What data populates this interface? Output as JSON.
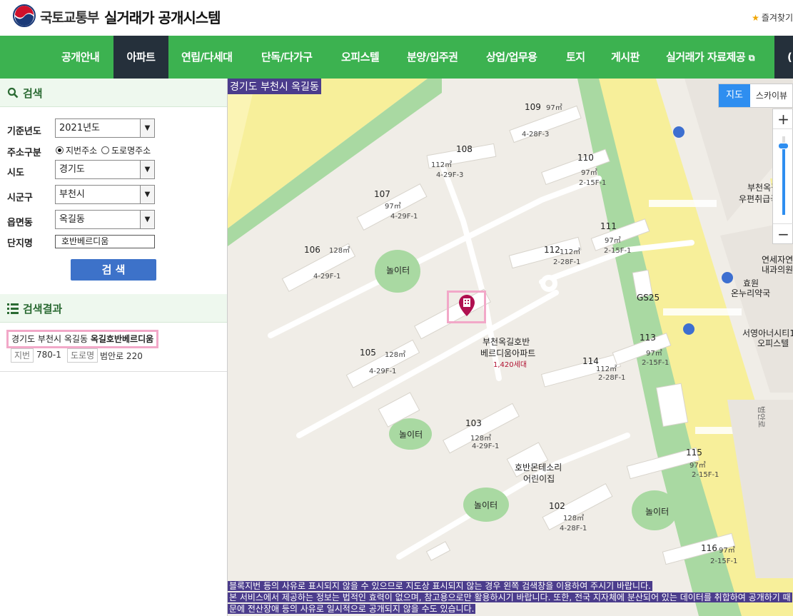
{
  "header": {
    "org": "국토교통부",
    "system": "실거래가 공개시스템",
    "favorite": "즐겨찾기"
  },
  "nav": {
    "items": [
      {
        "label": "공개안내",
        "active": false
      },
      {
        "label": "아파트",
        "active": true
      },
      {
        "label": "연립/다세대",
        "active": false
      },
      {
        "label": "단독/다가구",
        "active": false
      },
      {
        "label": "오피스텔",
        "active": false
      },
      {
        "label": "분양/입주권",
        "active": false
      },
      {
        "label": "상업/업무용",
        "active": false
      },
      {
        "label": "토지",
        "active": false
      },
      {
        "label": "게시판",
        "active": false
      },
      {
        "label": "실거래가 자료제공",
        "active": false
      }
    ]
  },
  "search": {
    "title": "검색",
    "year_label": "기준년도",
    "year_value": "2021년도",
    "addr_type_label": "주소구분",
    "addr_option_lot": "지번주소",
    "addr_option_road": "도로명주소",
    "sido_label": "시도",
    "sido_value": "경기도",
    "sigungu_label": "시군구",
    "sigungu_value": "부천시",
    "dong_label": "읍면동",
    "dong_value": "옥길동",
    "complex_label": "단지명",
    "complex_value": "호반베르디움",
    "button": "검 색"
  },
  "results": {
    "title": "검색결과",
    "item_address": "경기도 부천시 옥길동",
    "item_name": "옥길호반베르디움",
    "lot_tag": "지번",
    "lot_value": "780-1",
    "road_tag": "도로명",
    "road_value": "범안로 220"
  },
  "map": {
    "location_label": "경기도 부천시 옥길동",
    "type_map": "지도",
    "type_sky": "스카이뷰",
    "zoom_in": "+",
    "zoom_out": "−",
    "notice_1": "블록지번 등의 사유로 표시되지 않을 수 있으므로 지도상 표시되지 않는 경우 왼쪽 검색창을 이용하여 주시기 바랍니다.",
    "notice_2": "본 서비스에서 제공하는 정보는 법적인 효력이 없으며, 참고용으로만 활용하시기 바랍니다. 또한, 전국 지자체에 분산되어 있는 데이터를 취합하여 공개하기 때",
    "notice_3": "문에 전산장애 등의 사유로 일시적으로 공개되지 않을 수도 있습니다.",
    "complex_name_1": "부천옥길호반",
    "complex_name_2": "베르디움아파트",
    "households": "1,420세대",
    "playground": "놀이터",
    "daycare_1": "호반몬테소리",
    "daycare_2": "어린이집",
    "store": "GS25",
    "post_1": "부천옥길동",
    "post_2": "우편취급국",
    "clinic_1": "연세자연",
    "clinic_2": "내과의원",
    "pharmacy_1": "효원",
    "pharmacy_2": "온누리약국",
    "officetel_1": "서영아너시티1",
    "officetel_2": "오피스텔",
    "road_name": "범안로",
    "buildings": [
      {
        "no": "107",
        "plot": "4-29F-1",
        "area": "97㎡"
      },
      {
        "no": "108",
        "plot": "4-29F-3",
        "area": "112㎡"
      },
      {
        "no": "109",
        "plot": "4-28F-3",
        "area": "97㎡"
      },
      {
        "no": "110",
        "plot": "2-15F-1",
        "area": "97㎡"
      },
      {
        "no": "106",
        "plot": "4-29F-1",
        "area": "128㎡"
      },
      {
        "no": "111",
        "plot": "2-15F-1",
        "area": "97㎡"
      },
      {
        "no": "112",
        "plot": "2-28F-1",
        "area": "112㎡"
      },
      {
        "no": "105",
        "plot": "4-29F-1",
        "area": "128㎡"
      },
      {
        "no": "113",
        "plot": "2-15F-1",
        "area": "97㎡"
      },
      {
        "no": "114",
        "plot": "2-28F-1",
        "area": "112㎡"
      },
      {
        "no": "103",
        "plot": "4-29F-1",
        "area": "128㎡"
      },
      {
        "no": "115",
        "plot": "2-15F-1",
        "area": "97㎡"
      },
      {
        "no": "102",
        "plot": "4-28F-1",
        "area": "128㎡"
      },
      {
        "no": "116",
        "plot": "2-15F-1",
        "area": "97㎡"
      }
    ]
  }
}
